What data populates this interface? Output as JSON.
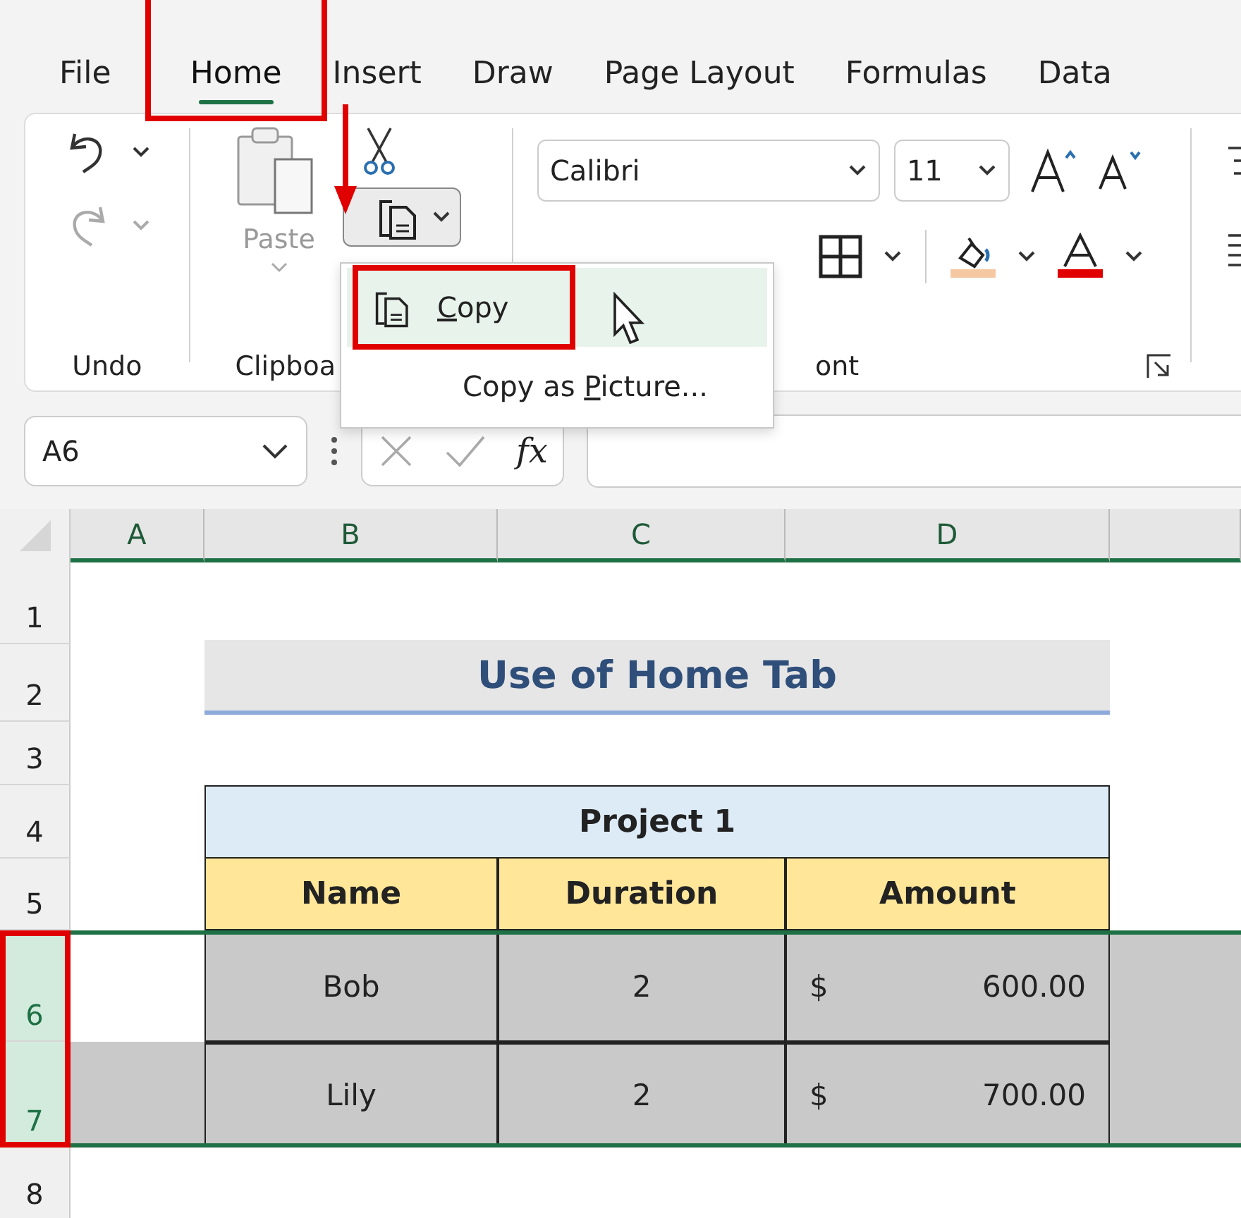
{
  "tabs": [
    {
      "label": "File",
      "selected": false,
      "annotated": false
    },
    {
      "label": "Home",
      "selected": true,
      "annotated": true
    },
    {
      "label": "Insert",
      "selected": false,
      "annotated": false
    },
    {
      "label": "Draw",
      "selected": false,
      "annotated": false
    },
    {
      "label": "Page Layout",
      "selected": false,
      "annotated": false
    },
    {
      "label": "Formulas",
      "selected": false,
      "annotated": false
    },
    {
      "label": "Data",
      "selected": false,
      "annotated": false
    }
  ],
  "ribbon": {
    "undo_group": {
      "label": "Undo",
      "redo_disabled": true
    },
    "clipboard_group": {
      "label": "Clipboa",
      "paste_label": "Paste",
      "paste_disabled": true,
      "copy_menu_open": true
    },
    "font_group": {
      "label": "ont",
      "font": "Calibri",
      "size": "11"
    }
  },
  "copy_menu": {
    "items": [
      {
        "key": "C",
        "rest": "opy",
        "icon": true,
        "selected": true,
        "annotated": true
      },
      {
        "lead": "Copy as ",
        "key": "P",
        "rest": "icture...",
        "icon": false,
        "selected": false,
        "annotated": false
      }
    ]
  },
  "formula_bar": {
    "name_box": "A6",
    "function_label": "fx"
  },
  "sheet": {
    "columns": [
      "A",
      "B",
      "C",
      "D"
    ],
    "row_numbers": [
      {
        "label": "1",
        "selected": false
      },
      {
        "label": "2",
        "selected": false
      },
      {
        "label": "3",
        "selected": false
      },
      {
        "label": "4",
        "selected": false
      },
      {
        "label": "5",
        "selected": false
      },
      {
        "label": "6",
        "selected": true
      },
      {
        "label": "7",
        "selected": true
      },
      {
        "label": "8",
        "selected": false
      }
    ],
    "selection_annotated": true,
    "title": "Use of Home Tab",
    "table": {
      "caption": "Project 1",
      "headers": [
        "Name",
        "Duration",
        "Amount"
      ],
      "rows": [
        {
          "name": "Bob",
          "duration": "2",
          "currency": "$",
          "amount": "600.00",
          "selected": true,
          "active": true
        },
        {
          "name": "Lily",
          "duration": "2",
          "currency": "$",
          "amount": "700.00",
          "selected": true,
          "active": false
        }
      ]
    }
  }
}
